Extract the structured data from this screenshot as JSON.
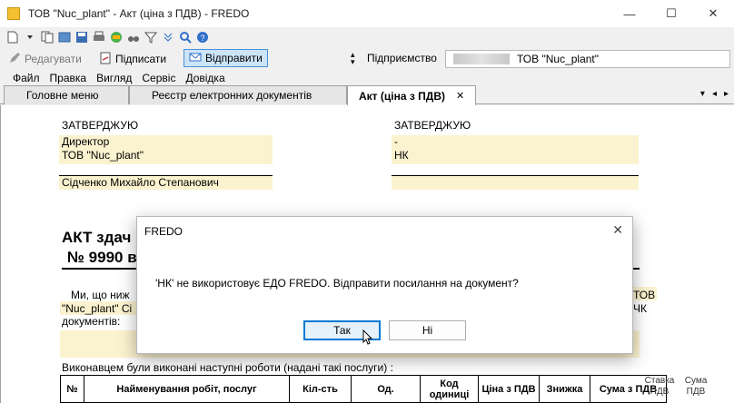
{
  "window": {
    "title": "ТОВ \"Nuc_plant\" - Акт (ціна з ПДВ) - FREDO",
    "minimize": "—",
    "maximize": "☐",
    "close": "✕"
  },
  "toolbar": {
    "edit_label": "Редагувати",
    "sign_label": "Підписати",
    "send_label": "Відправити",
    "enterprise_label": "Підприємство",
    "enterprise_value": "ТОВ \"Nuc_plant\""
  },
  "menu": [
    "Файл",
    "Правка",
    "Вигляд",
    "Сервіс",
    "Довідка"
  ],
  "tabs": [
    {
      "label": "Головне меню"
    },
    {
      "label": "Реєстр електронних документів"
    },
    {
      "label": "Акт (ціна з ПДВ)",
      "close": "✕"
    }
  ],
  "document": {
    "approve_left": {
      "heading": "ЗАТВЕРДЖУЮ",
      "position": "Директор",
      "org": "ТОВ \"Nuc_plant\"",
      "person": "Сідченко Михайло Степанович"
    },
    "approve_right": {
      "heading": "ЗАТВЕРДЖУЮ",
      "position": "-",
      "org": "НК"
    },
    "act_title": "АКТ здач",
    "act_number": "№ 9990 в",
    "para_line1": "Ми, що ниж",
    "para_line1_right": "ТОВ",
    "para_line2": "\"Nuc_plant\" Сі",
    "para_line2_right": "ЧК",
    "para_line3": "документів:",
    "works_intro": "Виконавцем були виконані наступні роботи (надані такі послуги) :",
    "table_headers": [
      "№",
      "Найменування робіт, послуг",
      "Кіл-сть",
      "Од.",
      "Код одиниці",
      "Ціна з ПДВ",
      "Знижка",
      "Сума з ПДВ"
    ],
    "side_headers": [
      "Ставка ПДВ",
      "Сума ПДВ"
    ]
  },
  "dialog": {
    "title": "FREDO",
    "close": "✕",
    "message": "'НК' не використовує ЕДО FREDO. Відправити посилання на документ?",
    "yes_label": "Так",
    "no_label": "Ні"
  }
}
